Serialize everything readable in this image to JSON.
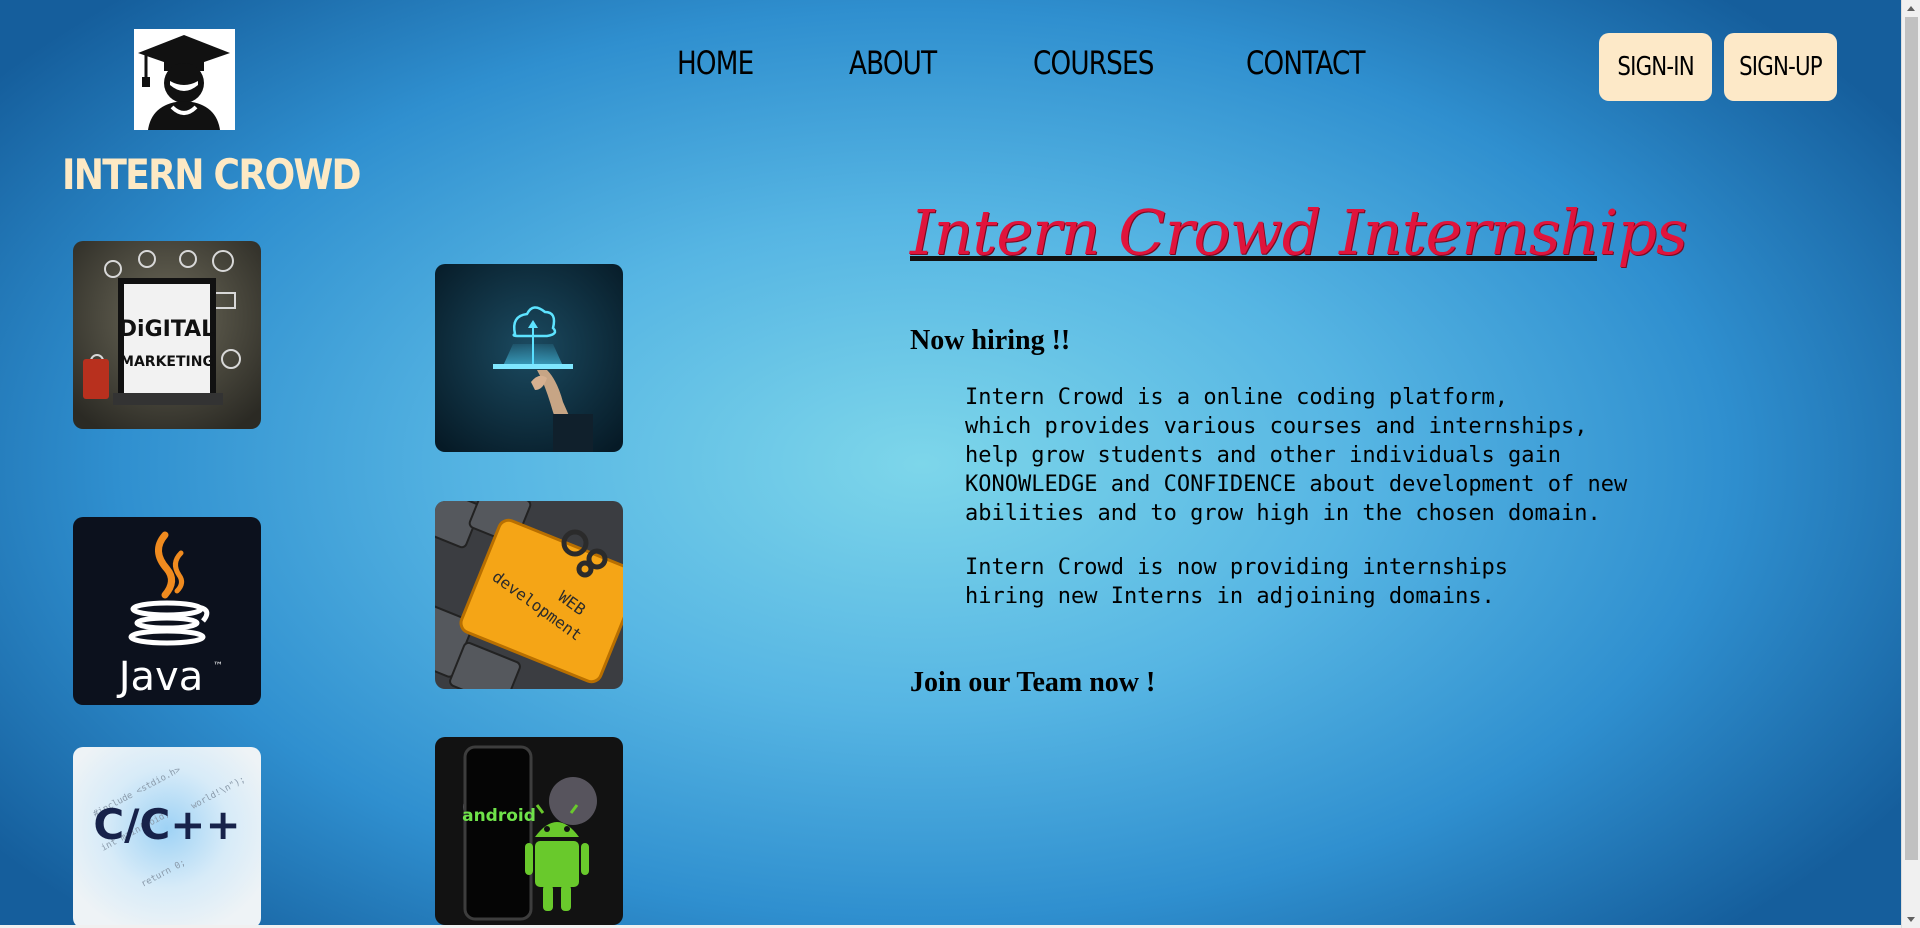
{
  "brand": {
    "name": "INTERN CROWD",
    "logo_icon": "graduate-cap-avatar-icon"
  },
  "nav": {
    "items": [
      "HOME",
      "ABOUT",
      "COURSES",
      "CONTACT"
    ]
  },
  "auth": {
    "sign_in": "SIGN-IN",
    "sign_up": "SIGN-UP"
  },
  "tiles": {
    "digital_marketing": {
      "line1": "DiGITAL",
      "line2": "MARKETING"
    },
    "cloud": {
      "icon": "cloud-upload-icon"
    },
    "java": {
      "label": "Java",
      "tm": "™"
    },
    "web_dev": {
      "line1": "WEB",
      "line2": "development"
    },
    "cpp": {
      "label": "C/C++"
    },
    "android": {
      "label": "android"
    }
  },
  "hero": {
    "title": "Intern Crowd Internships",
    "now_hiring": "Now hiring !!",
    "paragraph1": "Intern Crowd is a online coding platform,\nwhich provides various courses and internships,\nhelp grow students and other individuals gain\nKONOWLEDGE and CONFIDENCE about development of new\nabilities and to grow high in the chosen domain.",
    "paragraph2": "Intern Crowd is now providing internships\nhiring new Interns in adjoining domains.",
    "join": "Join our Team now !"
  },
  "colors": {
    "accent_red": "#e0143c",
    "brand_cream": "#fde9c4",
    "button_bg": "#fde9c8"
  }
}
